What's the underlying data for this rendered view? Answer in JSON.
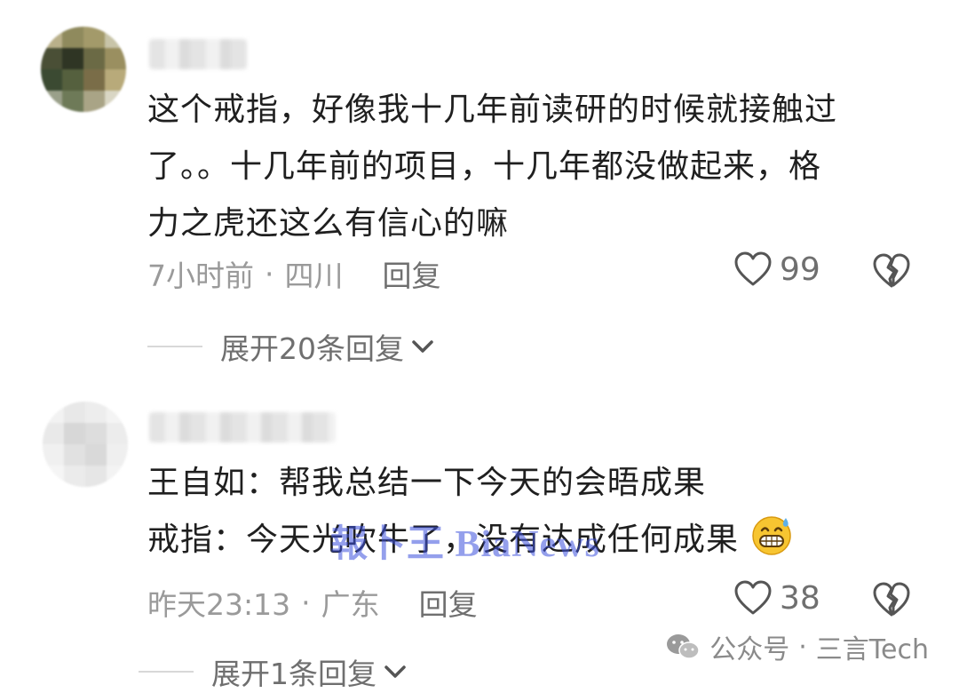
{
  "comments": [
    {
      "body": [
        "这个戒指，好像我十几年前读研的时候就接触过",
        "了。。十几年前的项目，十几年都没做起来，格",
        "力之虎还这么有信心的嘛"
      ],
      "time": "7小时前",
      "location": "四川",
      "reply_label": "回复",
      "likes": "99",
      "expand_label": "展开20条回复"
    },
    {
      "body": [
        "王自如：帮我总结一下今天的会晤成果",
        "戒指：今天光吹牛了，没有达成任何成果"
      ],
      "time": "昨天23:13",
      "location": "广东",
      "reply_label": "回复",
      "likes": "38",
      "expand_label": "展开1条回复"
    }
  ],
  "separator": "·",
  "watermark": "報卜王 BiaNews",
  "source": {
    "label": "公众号",
    "separator": "·",
    "name": "三言Tech"
  },
  "icons": {
    "like": "heart-outline-icon",
    "dislike": "broken-heart-icon",
    "expand": "chevron-down-icon",
    "emoji": "grinning-sweat-emoji",
    "source": "wechat-icon"
  }
}
